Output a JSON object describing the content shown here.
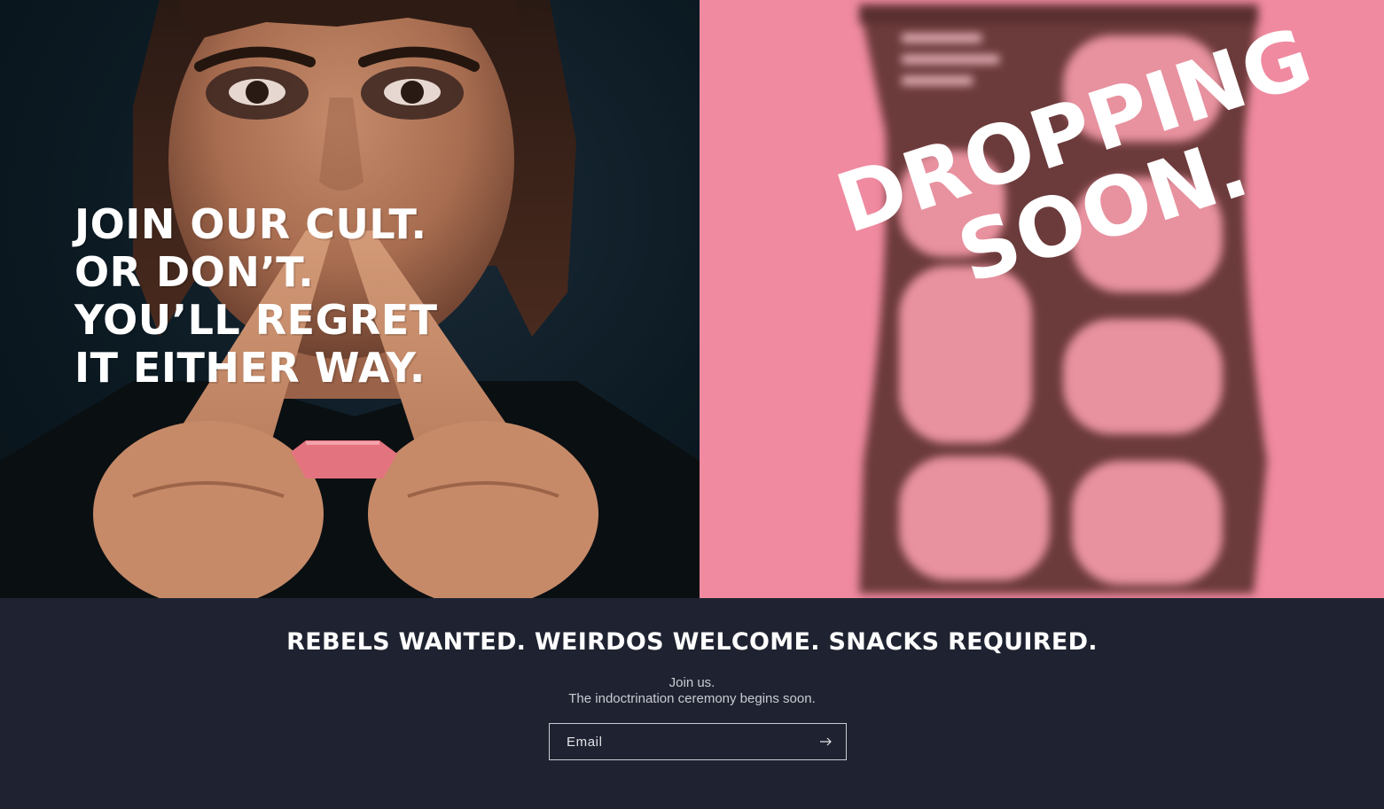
{
  "hero": {
    "left": {
      "headline_lines": [
        "Join our cult.",
        "Or don’t.",
        "You’ll regret",
        "it either way."
      ],
      "photo_icon": "portrait-photo"
    },
    "right": {
      "headline_lines": [
        "Dropping",
        "soon."
      ],
      "photo_icon": "snack-bag-photo",
      "background_color": "#f08aa0"
    }
  },
  "footer": {
    "tagline": "Rebels wanted. Weirdos welcome. Snacks required.",
    "subtext_line1": "Join us.",
    "subtext_line2": "The indoctrination ceremony begins soon.",
    "email_placeholder": "Email",
    "submit_icon": "arrow-right-icon",
    "background_color": "#1f2331"
  }
}
